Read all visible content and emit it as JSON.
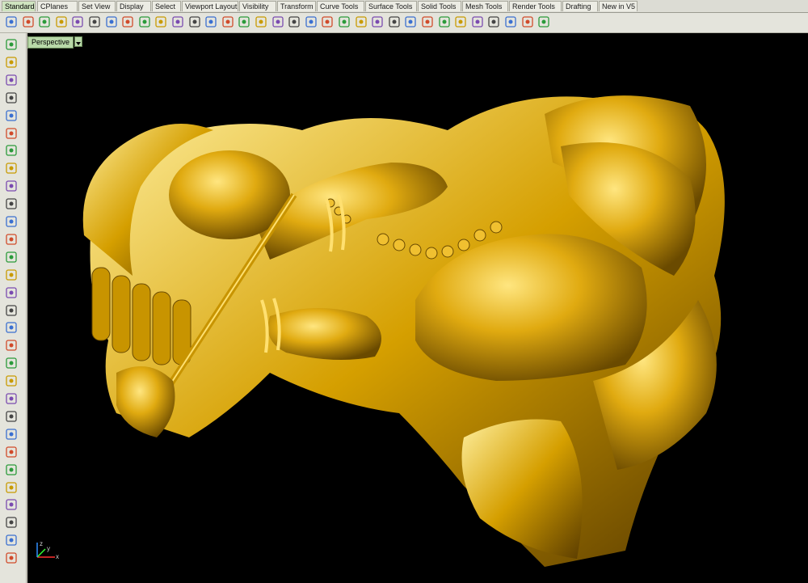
{
  "tabs": [
    {
      "label": "Standard",
      "active": true
    },
    {
      "label": "CPlanes",
      "active": false
    },
    {
      "label": "Set View",
      "active": false
    },
    {
      "label": "Display",
      "active": false
    },
    {
      "label": "Select",
      "active": false
    },
    {
      "label": "Viewport Layout",
      "active": false
    },
    {
      "label": "Visibility",
      "active": false
    },
    {
      "label": "Transform",
      "active": false
    },
    {
      "label": "Curve Tools",
      "active": false
    },
    {
      "label": "Surface Tools",
      "active": false
    },
    {
      "label": "Solid Tools",
      "active": false
    },
    {
      "label": "Mesh Tools",
      "active": false
    },
    {
      "label": "Render Tools",
      "active": false
    },
    {
      "label": "Drafting",
      "active": false
    },
    {
      "label": "New in V5",
      "active": false
    }
  ],
  "viewport": {
    "label": "Perspective"
  },
  "axes": {
    "x": "x",
    "y": "y",
    "z": "z"
  },
  "colors": {
    "model_gold": "#d9a400",
    "viewport_bg": "#000000",
    "active_tab": "#cfe4c0"
  },
  "toolbar_icons": [
    "new-file-icon",
    "open-file-icon",
    "save-icon",
    "print-icon",
    "import-icon",
    "export-icon",
    "cut-icon",
    "copy-icon",
    "paste-icon",
    "undo-icon",
    "pan-hand-icon",
    "move-icon",
    "zoom-icon",
    "zoom-window-icon",
    "zoom-extents-icon",
    "zoom-selected-icon",
    "rotate-view-icon",
    "viewport-layout-icon",
    "grid-icon",
    "car-icon",
    "lock-icon",
    "properties-icon",
    "layers-icon",
    "light-icon",
    "render-icon",
    "color-wheel-icon",
    "material-icon",
    "sphere-render-icon",
    "sphere-blue-icon",
    "lamp-icon",
    "settings-gear-icon",
    "tools-icon",
    "help-icon"
  ],
  "left_icons": [
    "select-arrow-icon",
    "point-icon",
    "polyline-icon",
    "curve-icon",
    "circle-icon",
    "arc-icon",
    "polygon-icon",
    "rectangle-icon",
    "ellipse-icon",
    "offset-icon",
    "fillet-icon",
    "surface-icon",
    "box-icon",
    "sphere-icon",
    "extrude-icon",
    "loft-icon",
    "boolean-icon",
    "array-icon",
    "transform-icon",
    "mirror-icon",
    "fill-icon",
    "group-icon",
    "split-icon",
    "rotate-icon",
    "text-icon",
    "dimension-icon",
    "block-icon",
    "edit-icon",
    "mesh-icon",
    "more-icon"
  ]
}
